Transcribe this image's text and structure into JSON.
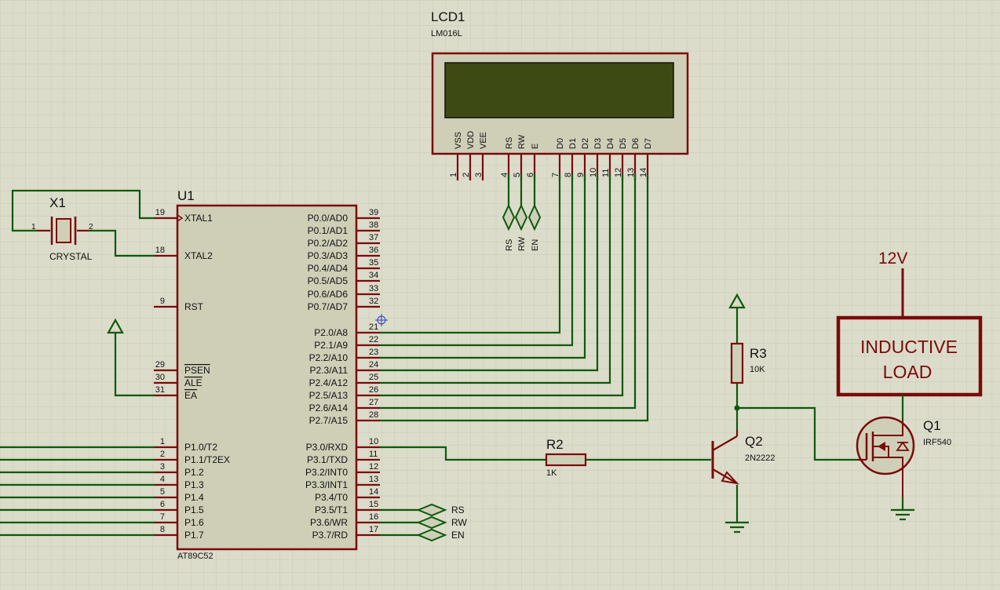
{
  "colors": {
    "background": "#dcdccb",
    "grid": "#c9c9b6",
    "wire": "#0b5a0b",
    "component": "#7a0a0a",
    "body_fill": "#cfcfb8",
    "lcd_screen": "#3e4a13",
    "text": "#111111"
  },
  "lcd": {
    "ref": "LCD1",
    "model": "LM016L",
    "pins": [
      "VSS",
      "VDD",
      "VEE",
      "RS",
      "RW",
      "E",
      "D0",
      "D1",
      "D2",
      "D3",
      "D4",
      "D5",
      "D6",
      "D7"
    ],
    "pin_numbers": [
      "1",
      "2",
      "3",
      "4",
      "5",
      "6",
      "7",
      "8",
      "9",
      "10",
      "11",
      "12",
      "13",
      "14"
    ],
    "terminals": [
      "RS",
      "RW",
      "EN"
    ]
  },
  "mcu": {
    "ref": "U1",
    "model": "AT89C52",
    "left_pins": [
      {
        "num": "19",
        "name": "XTAL1"
      },
      {
        "num": "18",
        "name": "XTAL2"
      },
      {
        "num": "9",
        "name": "RST"
      },
      {
        "num": "29",
        "name": "PSEN"
      },
      {
        "num": "30",
        "name": "ALE"
      },
      {
        "num": "31",
        "name": "EA"
      },
      {
        "num": "1",
        "name": "P1.0/T2"
      },
      {
        "num": "2",
        "name": "P1.1/T2EX"
      },
      {
        "num": "3",
        "name": "P1.2"
      },
      {
        "num": "4",
        "name": "P1.3"
      },
      {
        "num": "5",
        "name": "P1.4"
      },
      {
        "num": "6",
        "name": "P1.5"
      },
      {
        "num": "7",
        "name": "P1.6"
      },
      {
        "num": "8",
        "name": "P1.7"
      }
    ],
    "right_pins": [
      {
        "num": "39",
        "name": "P0.0/AD0"
      },
      {
        "num": "38",
        "name": "P0.1/AD1"
      },
      {
        "num": "37",
        "name": "P0.2/AD2"
      },
      {
        "num": "36",
        "name": "P0.3/AD3"
      },
      {
        "num": "35",
        "name": "P0.4/AD4"
      },
      {
        "num": "34",
        "name": "P0.5/AD5"
      },
      {
        "num": "33",
        "name": "P0.6/AD6"
      },
      {
        "num": "32",
        "name": "P0.7/AD7"
      },
      {
        "num": "21",
        "name": "P2.0/A8"
      },
      {
        "num": "22",
        "name": "P2.1/A9"
      },
      {
        "num": "23",
        "name": "P2.2/A10"
      },
      {
        "num": "24",
        "name": "P2.3/A11"
      },
      {
        "num": "25",
        "name": "P2.4/A12"
      },
      {
        "num": "26",
        "name": "P2.5/A13"
      },
      {
        "num": "27",
        "name": "P2.6/A14"
      },
      {
        "num": "28",
        "name": "P2.7/A15"
      },
      {
        "num": "10",
        "name": "P3.0/RXD"
      },
      {
        "num": "11",
        "name": "P3.1/TXD"
      },
      {
        "num": "12",
        "name": "P3.2/INT0"
      },
      {
        "num": "13",
        "name": "P3.3/INT1"
      },
      {
        "num": "14",
        "name": "P3.4/T0"
      },
      {
        "num": "15",
        "name": "P3.5/T1"
      },
      {
        "num": "16",
        "name": "P3.6/WR"
      },
      {
        "num": "17",
        "name": "P3.7/RD"
      }
    ],
    "terminals": [
      "RS",
      "RW",
      "EN"
    ]
  },
  "crystal": {
    "ref": "X1",
    "model": "CRYSTAL",
    "pin1": "1",
    "pin2": "2"
  },
  "r2": {
    "ref": "R2",
    "value": "1K"
  },
  "r3": {
    "ref": "R3",
    "value": "10K"
  },
  "q2": {
    "ref": "Q2",
    "model": "2N2222"
  },
  "q1": {
    "ref": "Q1",
    "model": "IRF540"
  },
  "supply": {
    "label": "12V"
  },
  "load": {
    "line1": "INDUCTIVE",
    "line2": "LOAD"
  }
}
